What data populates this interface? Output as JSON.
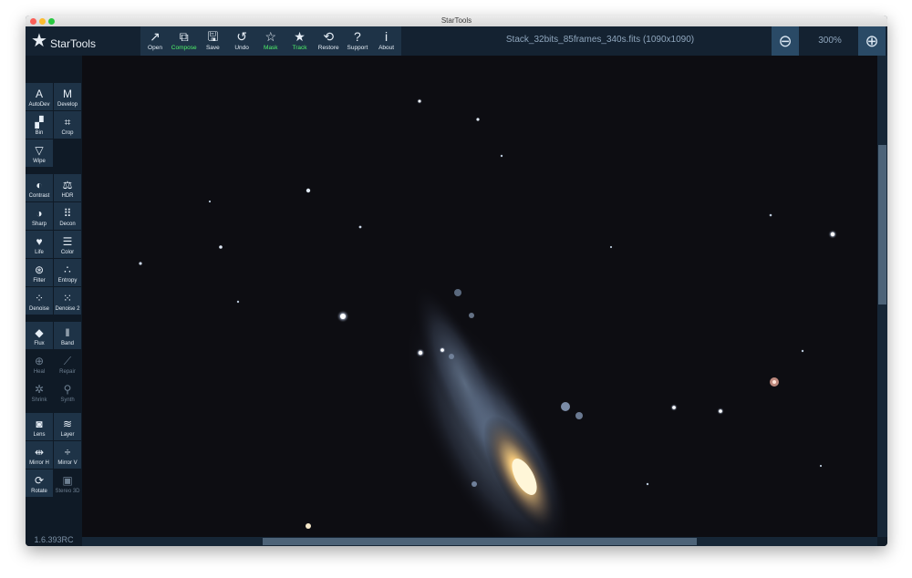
{
  "window": {
    "title": "StarTools"
  },
  "logo": {
    "name": "StarTools",
    "icon": "star-icon"
  },
  "toolbar": [
    {
      "label": "Open",
      "icon": "↗",
      "highlight": false
    },
    {
      "label": "Compose",
      "icon": "⧉",
      "highlight": true
    },
    {
      "label": "Save",
      "icon": "🖫",
      "highlight": false
    },
    {
      "label": "Undo",
      "icon": "↺",
      "highlight": false
    },
    {
      "label": "Mask",
      "icon": "☆",
      "highlight": true
    },
    {
      "label": "Track",
      "icon": "★",
      "highlight": true
    },
    {
      "label": "Restore",
      "icon": "⟲",
      "highlight": false
    },
    {
      "label": "Support",
      "icon": "?",
      "highlight": false
    },
    {
      "label": "About",
      "icon": "i",
      "highlight": false
    }
  ],
  "file": {
    "name": "Stack_32bits_85frames_340s.fits (1090x1090)"
  },
  "zoom": {
    "out_icon": "zoom-out-icon",
    "level": "300%",
    "in_icon": "zoom-in-icon"
  },
  "modules": [
    {
      "label": "AutoDev",
      "icon": "A",
      "active": true
    },
    {
      "label": "Develop",
      "icon": "M",
      "active": true
    },
    {
      "label": "Bin",
      "icon": "▞",
      "active": true
    },
    {
      "label": "Crop",
      "icon": "⌗",
      "active": true
    },
    {
      "label": "Wipe",
      "icon": "▽",
      "active": true
    },
    {
      "label": "Contrast",
      "icon": "◐",
      "active": true
    },
    {
      "label": "HDR",
      "icon": "⚖",
      "active": true
    },
    {
      "label": "Sharp",
      "icon": "◑",
      "active": true
    },
    {
      "label": "Decon",
      "icon": "⠿",
      "active": true
    },
    {
      "label": "Life",
      "icon": "♥",
      "active": true
    },
    {
      "label": "Color",
      "icon": "☰",
      "active": true
    },
    {
      "label": "Filter",
      "icon": "⊛",
      "active": true
    },
    {
      "label": "Entropy",
      "icon": "∴",
      "active": true
    },
    {
      "label": "Denoise",
      "icon": "⁘",
      "active": true
    },
    {
      "label": "Denoise 2",
      "icon": "⁙",
      "active": true
    },
    {
      "label": "Flux",
      "icon": "◆",
      "active": true
    },
    {
      "label": "Band",
      "icon": "‖",
      "active": true
    },
    {
      "label": "Heal",
      "icon": "⊕",
      "active": false
    },
    {
      "label": "Repair",
      "icon": "⟋",
      "active": false
    },
    {
      "label": "Shrink",
      "icon": "✲",
      "active": false
    },
    {
      "label": "Synth",
      "icon": "⚲",
      "active": false
    },
    {
      "label": "Lens",
      "icon": "◙",
      "active": true
    },
    {
      "label": "Layer",
      "icon": "≋",
      "active": true
    },
    {
      "label": "Mirror H",
      "icon": "⇹",
      "active": true
    },
    {
      "label": "Mirror V",
      "icon": "÷",
      "active": true
    },
    {
      "label": "Rotate",
      "icon": "⟳",
      "active": true
    },
    {
      "label": "Stereo 3D",
      "icon": "▣",
      "active": false
    }
  ],
  "version": "1.6.393RC",
  "image": {
    "subject": "spiral-galaxy"
  },
  "colors": {
    "toolbar_bg": "#142231",
    "button_bg": "#1e3347",
    "highlight": "#4ff26a",
    "canvas_bg": "#0d0d12"
  }
}
